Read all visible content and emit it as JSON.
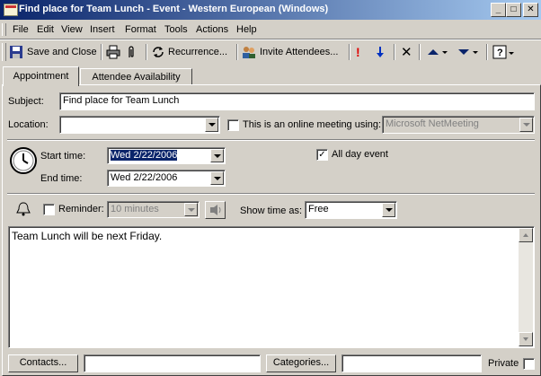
{
  "window": {
    "title": "Find place for Team Lunch - Event  - Western European (Windows)"
  },
  "menu": [
    "File",
    "Edit",
    "View",
    "Insert",
    "Format",
    "Tools",
    "Actions",
    "Help"
  ],
  "toolbar": {
    "save_close": "Save and Close",
    "recurrence": "Recurrence...",
    "invite": "Invite Attendees..."
  },
  "tabs": [
    "Appointment",
    "Attendee Availability"
  ],
  "form": {
    "subject_label": "Subject:",
    "subject_value": "Find place for Team Lunch",
    "location_label": "Location:",
    "location_value": "",
    "online_label": "This is an online meeting using:",
    "online_value": "Microsoft NetMeeting",
    "start_label": "Start time:",
    "start_value": "Wed 2/22/2006",
    "end_label": "End time:",
    "end_value": "Wed 2/22/2006",
    "allday_label": "All day event",
    "allday_checked": "✓",
    "reminder_label": "Reminder:",
    "reminder_value": "10 minutes",
    "showas_label": "Show time as:",
    "showas_value": "Free",
    "body": "Team Lunch will be next Friday.",
    "contacts_button": "Contacts...",
    "categories_button": "Categories...",
    "private_label": "Private"
  }
}
